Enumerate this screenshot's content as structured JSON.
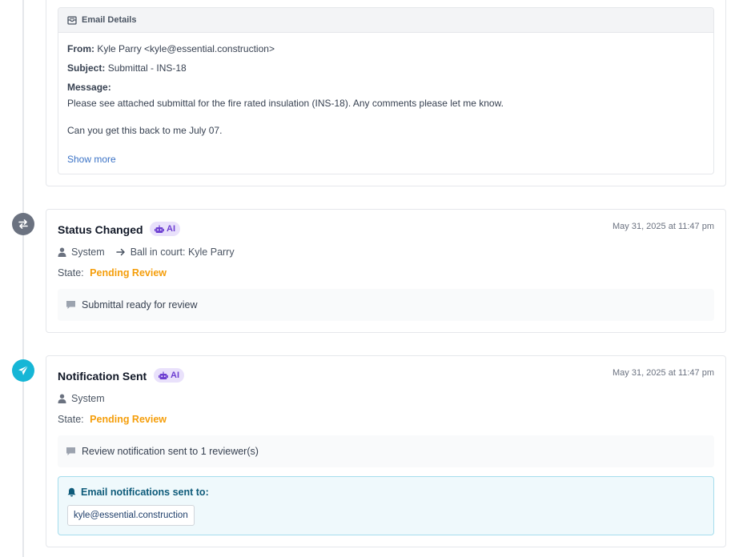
{
  "email_details": {
    "header": "Email Details",
    "from_label": "From:",
    "from_value": "Kyle Parry <kyle@essential.construction>",
    "subject_label": "Subject:",
    "subject_value": "Submittal - INS-18",
    "message_label": "Message:",
    "message_line1": "Please see attached submittal for the fire rated insulation (INS-18). Any comments please let me know.",
    "message_line2": "Can you get this back to me July 07.",
    "show_more": "Show more"
  },
  "events": [
    {
      "title": "Status Changed",
      "badge": "AI",
      "timestamp": "May 31, 2025 at 11:47 pm",
      "actor": "System",
      "ball_in_court": "Ball in court: Kyle Parry",
      "state_label": "State:",
      "state_value": "Pending Review",
      "comment": "Submittal ready for review"
    },
    {
      "title": "Notification Sent",
      "badge": "AI",
      "timestamp": "May 31, 2025 at 11:47 pm",
      "actor": "System",
      "state_label": "State:",
      "state_value": "Pending Review",
      "comment": "Review notification sent to 1 reviewer(s)",
      "notifications_title": "Email notifications sent to:",
      "recipients": [
        "kyle@essential.construction"
      ]
    }
  ],
  "colors": {
    "state_pending": "#f59e0b",
    "ai_badge_bg": "#e9e1fb",
    "ai_badge_text": "#6d3fd1",
    "status_icon_bg": "#6b7280",
    "notification_icon_bg": "#16b6d6",
    "link": "#3b73c6"
  },
  "icons": {
    "email_header": "envelope-open-icon",
    "status_changed": "exchange-arrows-icon",
    "notification_sent": "paper-plane-icon",
    "actor": "user-icon",
    "ball_in_court": "arrow-right-icon",
    "comment": "comment-icon",
    "notifications": "bell-icon",
    "ai": "robot-icon"
  }
}
